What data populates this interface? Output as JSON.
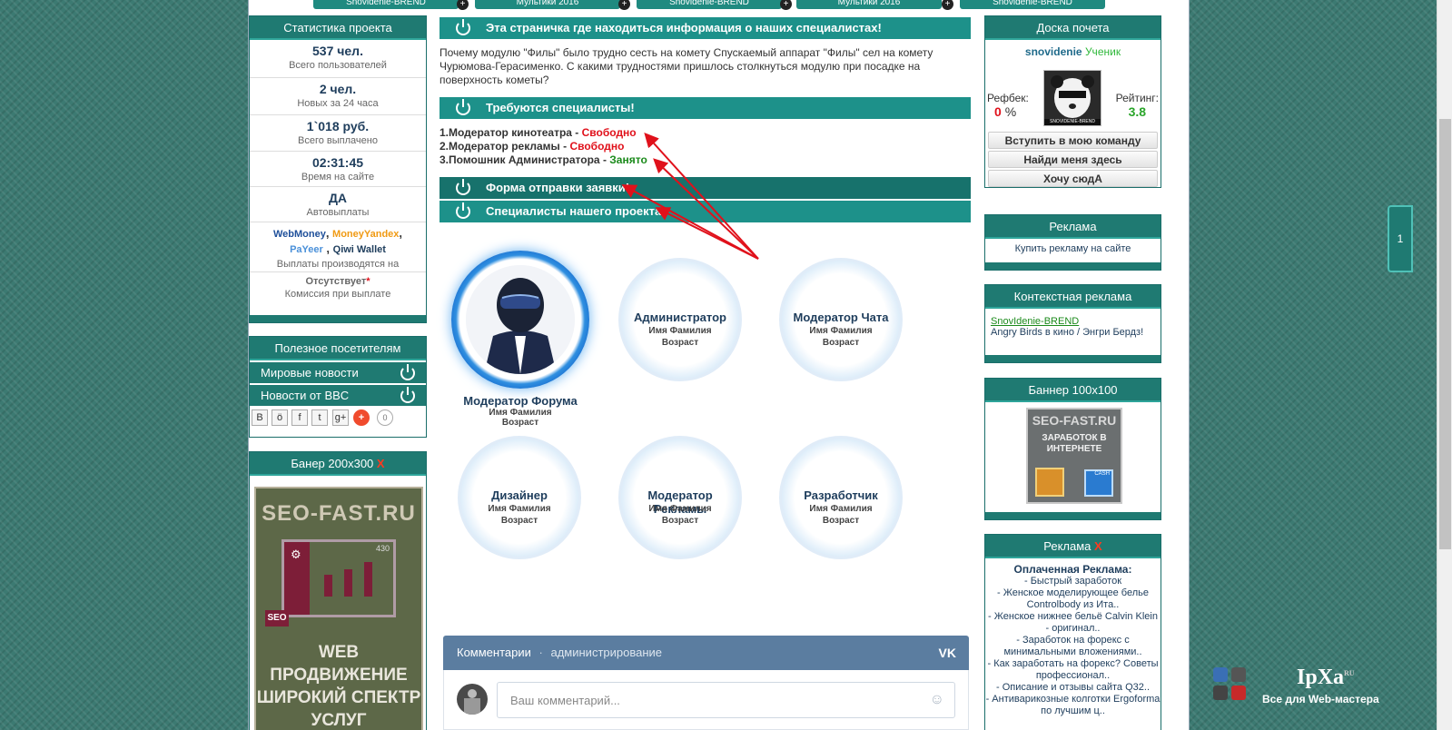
{
  "top_tabs": [
    "Snovidenie-BREND",
    "Мультики 2016",
    "Snovidenie-BREND",
    "Мультики 2016",
    "Snovidenie-BREND"
  ],
  "stats": {
    "title": "Статистика проекта",
    "items": [
      {
        "value": "537 чел.",
        "label": "Всего пользователей"
      },
      {
        "value": "2 чел.",
        "label": "Новых за 24 часа"
      },
      {
        "value": "1`018 руб.",
        "label": "Всего выплачено"
      },
      {
        "value": "02:31:45",
        "label": "Время на сайте"
      },
      {
        "value": "ДА",
        "label": "Автовыплаты"
      }
    ],
    "payments": {
      "webmoney": "WebMoney",
      "yandex": "MoneyYandex",
      "payeer": "PaYeer",
      "qiwi": "Qiwi Wallet",
      "label": "Выплаты производятся на"
    },
    "commission": {
      "value": "Отсутствует",
      "star": "*",
      "label": "Комиссия при выплате"
    }
  },
  "useful": {
    "title": "Полезное посетителям",
    "items": [
      "Мировые новости",
      "Новости от BBC"
    ],
    "share": {
      "b": "B",
      "ok": "ö",
      "fb": "f",
      "tw": "t",
      "gp": "g+",
      "plus": "+",
      "count": "0"
    }
  },
  "banner200": {
    "title": "Банер 200x300",
    "close": "X",
    "brand": "SEO-FAST.RU",
    "num": "430",
    "seo": "SEO",
    "line1": "WEB",
    "line2": "ПРОДВИЖЕНИЕ",
    "line3": "ШИРОКИЙ СПЕКТР",
    "line4": "УСЛУГ"
  },
  "main": {
    "bar1": "Эта страничка где находиться информация о наших специалистах!",
    "intro": "Почему модулю \"Филы\" было трудно сесть на комету Спускаемый аппарат \"Филы\" сел на комету Чурюмова-Герасименко. С какими трудностями пришлось столкнуться модулю при посадке на поверхность кометы?",
    "bar2": "Требуются специалисты!",
    "specs": [
      {
        "num": "1.",
        "name": "Модератор кинотеатра",
        "sep": " - ",
        "status": "Свободно"
      },
      {
        "num": "2.",
        "name": "Модератор рекламы",
        "sep": " - ",
        "status": "Свободно"
      },
      {
        "num": "3.",
        "name": "Помошник Администратора",
        "sep": " - ",
        "status": "Занято"
      }
    ],
    "bar3": "Форма отправки заявки!",
    "bar4": "Специалисты нашего проекта!",
    "team": [
      {
        "title": "Модератор Форума",
        "name": "Имя Фамилия",
        "age": "Возраст"
      },
      {
        "title": "Администратор",
        "name": "Имя Фамилия",
        "age": "Возраст"
      },
      {
        "title": "Модератор Чата",
        "name": "Имя Фамилия",
        "age": "Возраст"
      },
      {
        "title": "Дизайнер",
        "name": "Имя Фамилия",
        "age": "Возраст"
      },
      {
        "title": "Модератор Рекламы",
        "name": "Имя Фамилия",
        "age": "Возраст"
      },
      {
        "title": "Разработчик",
        "name": "Имя Фамилия",
        "age": "Возраст"
      }
    ],
    "comments": {
      "title": "Комментарии",
      "dot": "·",
      "admin": "администрирование",
      "placeholder": "Ваш комментарий...",
      "vk": "VK"
    }
  },
  "right": {
    "board_title": "Доска почета",
    "user": "snovidenie",
    "rank": "Ученик",
    "refback_label": "Рефбек:",
    "refback_value": "0",
    "refback_unit": "%",
    "rating_label": "Рейтинг:",
    "rating_value": "3.8",
    "avatar_caption": "SNOVIDENIE-BREND",
    "buttons": [
      "Вступить в мою команду",
      "Найди меня здесь",
      "Хочу сюдА"
    ],
    "ads_title": "Реклама",
    "ads_link": "Купить рекламу на сайте",
    "context_title": "Контекстная реклама",
    "context_link": "SnovIdenie-BREND",
    "context_text": "Angry Birds в кино / Энгри Бердз!",
    "banner100_title": "Баннер 100x100",
    "banner100_brand": "SEO-FAST.RU",
    "banner100_text": "ЗАРАБОТОК В ИНТЕРНЕТЕ",
    "banner100_cash": "CASH",
    "paid_title": "Реклама",
    "paid_close": "X",
    "paid_head": "Оплаченная Реклама:",
    "paid_items": [
      "- Быстрый заработок",
      "- Женское моделирующее белье Controlbody из Ита..",
      "- Женское нижнее бельё Calvin Klein - оригинал..",
      "- Заработок на форекс с минимальными вложениями..",
      "- Как заработать на форекс? Советы профессионал..",
      "- Описание и отзывы сайта Q32..",
      "- Антиварикозные колготки Ergoforma по лучшим ц.."
    ]
  },
  "side_tab": "1",
  "watermark": {
    "brand": "IpXa",
    "sup": "RU",
    "tagline": "Все для Web-мастера"
  }
}
